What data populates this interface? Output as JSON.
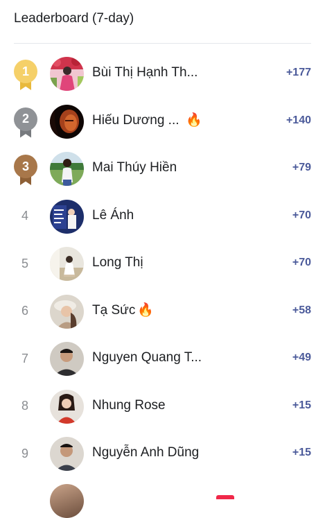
{
  "header": {
    "title": "Leaderboard (7-day)"
  },
  "entries": [
    {
      "rank": "1",
      "medal": "gold",
      "name": "Bùi Thị Hạnh Th...",
      "fire": false,
      "score": "+177"
    },
    {
      "rank": "2",
      "medal": "silver",
      "name": "Hiếu Dương ...",
      "fire": true,
      "score": "+140"
    },
    {
      "rank": "3",
      "medal": "bronze",
      "name": "Mai Thúy Hiền",
      "fire": false,
      "score": "+79"
    },
    {
      "rank": "4",
      "medal": "",
      "name": "Lê Ánh",
      "fire": false,
      "score": "+70"
    },
    {
      "rank": "5",
      "medal": "",
      "name": "Long Thị",
      "fire": false,
      "score": "+70"
    },
    {
      "rank": "6",
      "medal": "",
      "name": "Tạ Sức",
      "fire": true,
      "score": "+58"
    },
    {
      "rank": "7",
      "medal": "",
      "name": "Nguyen Quang T...",
      "fire": false,
      "score": "+49"
    },
    {
      "rank": "8",
      "medal": "",
      "name": "Nhung Rose",
      "fire": false,
      "score": "+15"
    },
    {
      "rank": "9",
      "medal": "",
      "name": "Nguyễn Anh Dũng",
      "fire": false,
      "score": "+15"
    }
  ],
  "icons": {
    "fire": "🔥"
  },
  "colors": {
    "score": "#4b5a9a",
    "gold": "#f5d069",
    "silver": "#8f9296",
    "bronze": "#a8774a"
  }
}
